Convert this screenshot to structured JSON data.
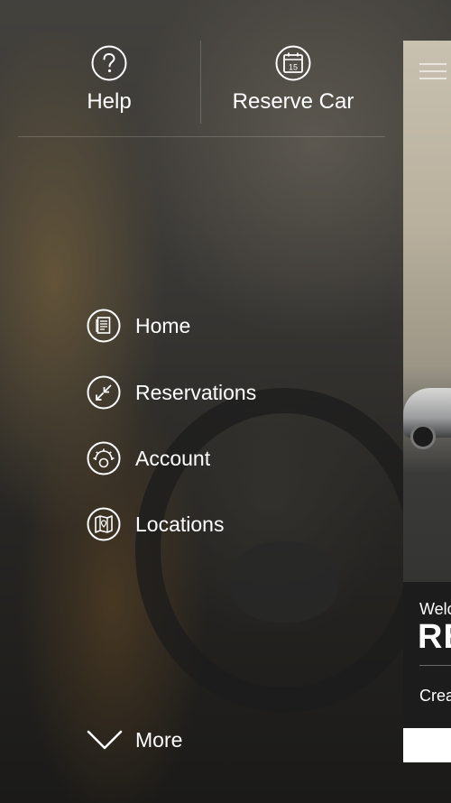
{
  "top_actions": {
    "help_label": "Help",
    "reserve_label": "Reserve Car",
    "calendar_day": "15"
  },
  "nav": {
    "items": [
      {
        "label": "Home",
        "icon": "home-icon"
      },
      {
        "label": "Reservations",
        "icon": "reservations-icon"
      },
      {
        "label": "Account",
        "icon": "account-gear-icon"
      },
      {
        "label": "Locations",
        "icon": "map-icon"
      }
    ],
    "more_label": "More"
  },
  "peek": {
    "welcome_partial": "Welc",
    "brand_partial": "RE",
    "create_partial": "Crea"
  },
  "colors": {
    "text": "#ffffff",
    "overlay": "#2e2c28"
  }
}
